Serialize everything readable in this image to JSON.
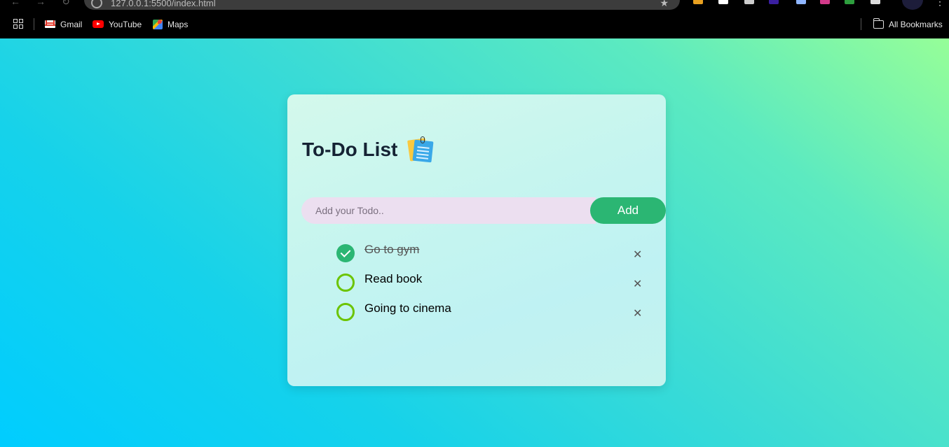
{
  "browser": {
    "url": "127.0.0.1:5500/index.html",
    "bookmarks": [
      {
        "label": "Gmail"
      },
      {
        "label": "YouTube"
      },
      {
        "label": "Maps"
      }
    ],
    "all_bookmarks_label": "All Bookmarks"
  },
  "app": {
    "title": "To-Do List",
    "input": {
      "placeholder": "Add your Todo..",
      "value": ""
    },
    "add_label": "Add",
    "todos": [
      {
        "text": "Go to gym",
        "done": true
      },
      {
        "text": "Read book",
        "done": false
      },
      {
        "text": "Going to cinema",
        "done": false
      }
    ],
    "delete_glyph": "✕"
  },
  "colors": {
    "accent_green": "#2bb673",
    "check_outline": "#6cc400",
    "input_bg": "#ecdff0"
  }
}
